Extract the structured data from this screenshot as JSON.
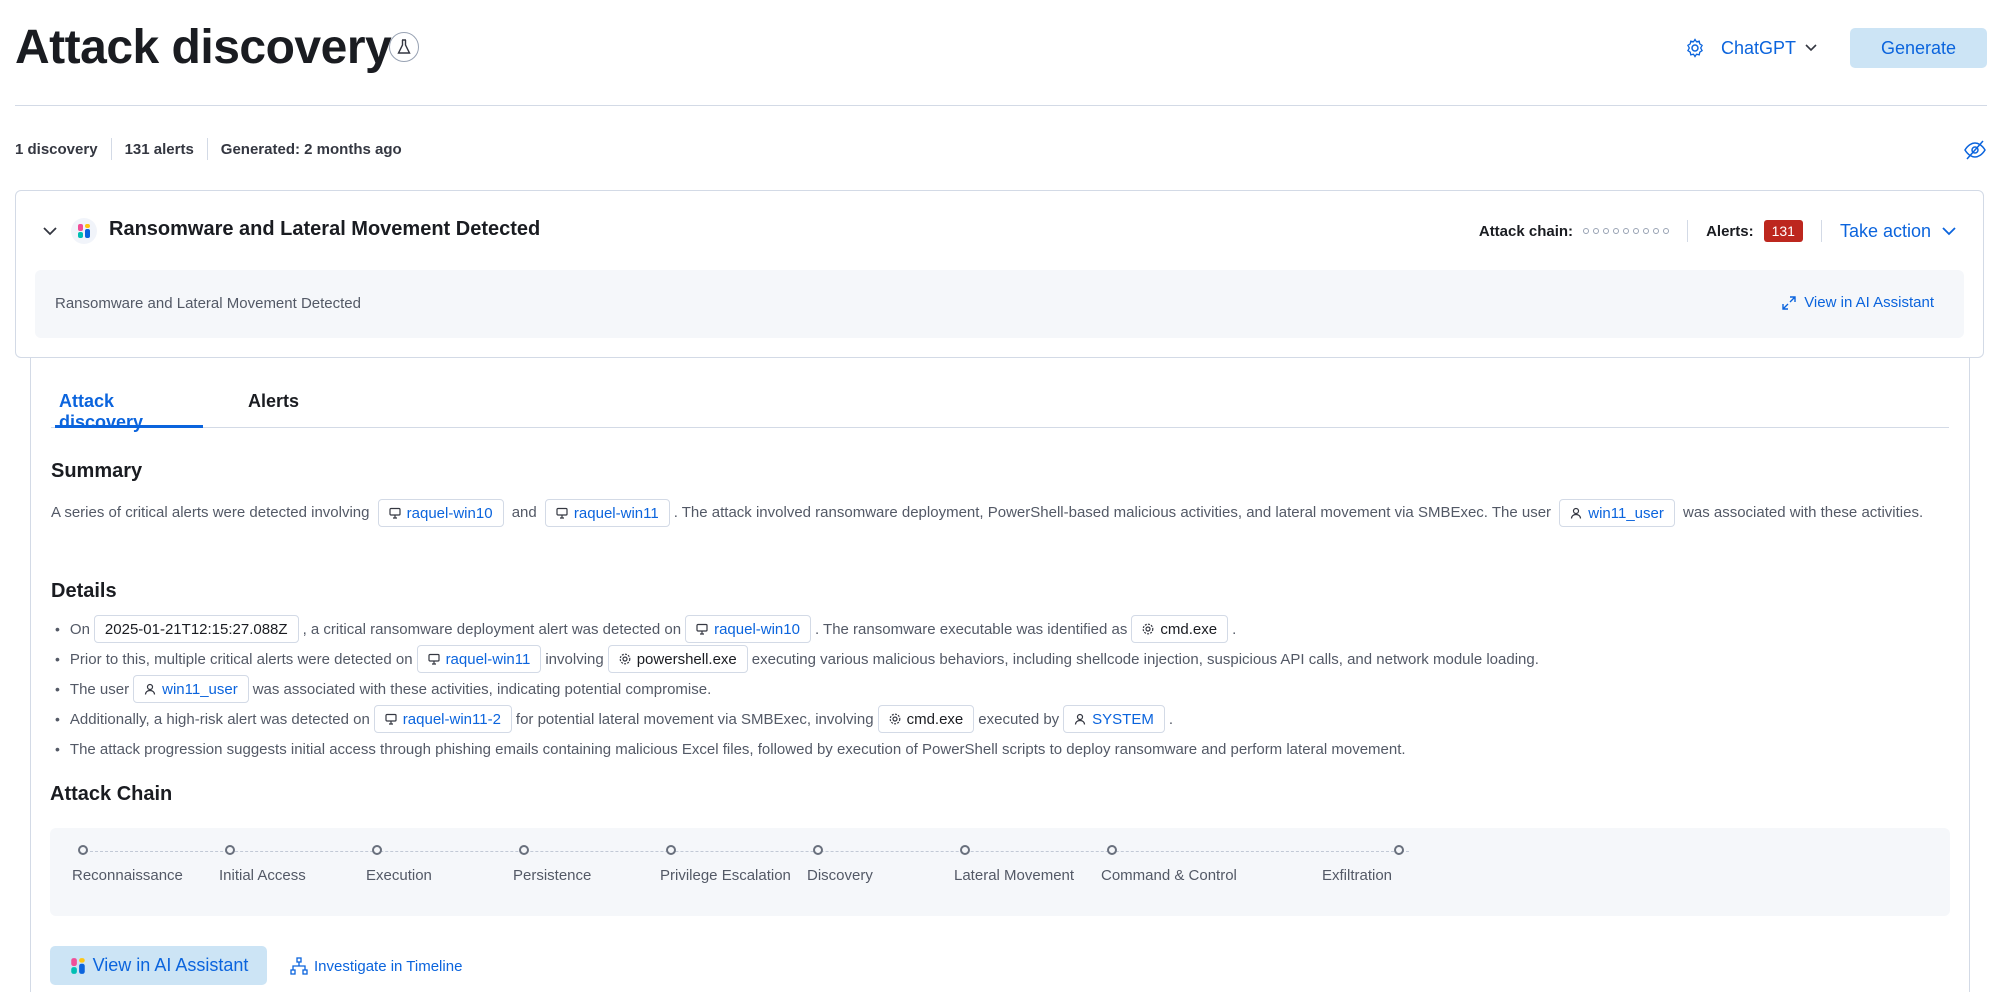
{
  "header": {
    "title": "Attack discovery",
    "connector": "ChatGPT",
    "generate_label": "Generate"
  },
  "stats": {
    "discoveries": "1 discovery",
    "alerts": "131 alerts",
    "generated": "Generated: 2 months ago"
  },
  "card": {
    "title": "Ransomware and Lateral Movement Detected",
    "attack_chain_label": "Attack chain:",
    "alerts_label": "Alerts:",
    "alerts_count": "131",
    "take_action": "Take action",
    "panel_text": "Ransomware and Lateral Movement Detected",
    "view_ai": "View in AI Assistant"
  },
  "tabs": {
    "discovery": "Attack discovery",
    "alerts": "Alerts"
  },
  "summary": {
    "heading": "Summary",
    "t1": "A series of critical alerts were detected involving",
    "host1": "raquel-win10",
    "t2": "and",
    "host2": "raquel-win11",
    "t3": ". The attack involved ransomware deployment, PowerShell-based malicious activities, and lateral movement via SMBExec. The user",
    "user": "win11_user",
    "t4": "was associated with these activities."
  },
  "details": {
    "heading": "Details",
    "l1": {
      "a": "On",
      "ts": "2025-01-21T12:15:27.088Z",
      "b": ", a critical ransomware deployment alert was detected on",
      "host": "raquel-win10",
      "c": ". The ransomware executable was identified as",
      "proc": "cmd.exe",
      "d": "."
    },
    "l2": {
      "a": "Prior to this, multiple critical alerts were detected on",
      "host": "raquel-win11",
      "b": "involving",
      "proc": "powershell.exe",
      "c": "executing various malicious behaviors, including shellcode injection, suspicious API calls, and network module loading."
    },
    "l3": {
      "a": "The user",
      "user": "win11_user",
      "b": "was associated with these activities, indicating potential compromise."
    },
    "l4": {
      "a": "Additionally, a high-risk alert was detected on",
      "host": "raquel-win11-2",
      "b": "for potential lateral movement via SMBExec, involving",
      "proc": "cmd.exe",
      "c": "executed by",
      "user": "SYSTEM",
      "d": "."
    },
    "l5": {
      "a": "The attack progression suggests initial access through phishing emails containing malicious Excel files, followed by execution of PowerShell scripts to deploy ransomware and perform lateral movement."
    }
  },
  "attack_chain": {
    "heading": "Attack Chain",
    "tactics": [
      "Reconnaissance",
      "Initial Access",
      "Execution",
      "Persistence",
      "Privilege Escalation",
      "Discovery",
      "Lateral Movement",
      "Command & Control",
      "Exfiltration"
    ]
  },
  "footer": {
    "view_ai": "View in AI Assistant",
    "timeline": "Investigate in Timeline"
  },
  "colors": {
    "accent": "#0b64dd",
    "danger": "#bd271e",
    "primary_bg": "#cce4f5"
  },
  "icons": [
    "beaker-icon",
    "gear-icon",
    "chevron-down-icon",
    "eye-closed-icon",
    "ai-assistant-icon",
    "expand-icon",
    "host-icon",
    "process-icon",
    "user-icon",
    "timeline-icon"
  ]
}
